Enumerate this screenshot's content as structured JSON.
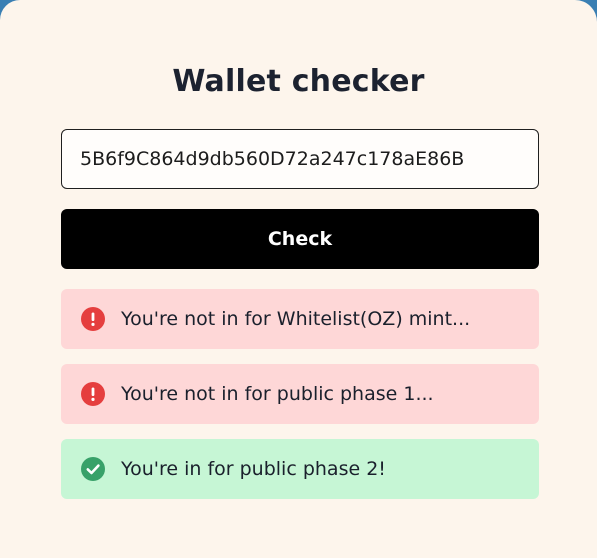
{
  "page": {
    "title": "Wallet checker"
  },
  "form": {
    "wallet_value": "5B6f9C864d9db560D72a247c178aE86B",
    "check_label": "Check"
  },
  "results": [
    {
      "status": "error",
      "icon": "exclamation-circle-icon",
      "text": "You're not in for Whitelist(OZ) mint..."
    },
    {
      "status": "error",
      "icon": "exclamation-circle-icon",
      "text": "You're not in for public phase 1..."
    },
    {
      "status": "success",
      "icon": "check-circle-icon",
      "text": "You're in for public phase 2!"
    }
  ],
  "colors": {
    "error_bg": "#fed7d7",
    "error_icon": "#e53e3e",
    "success_bg": "#c6f6d5",
    "success_icon": "#38a169",
    "button_bg": "#000000",
    "card_bg": "#fdf5ec"
  }
}
